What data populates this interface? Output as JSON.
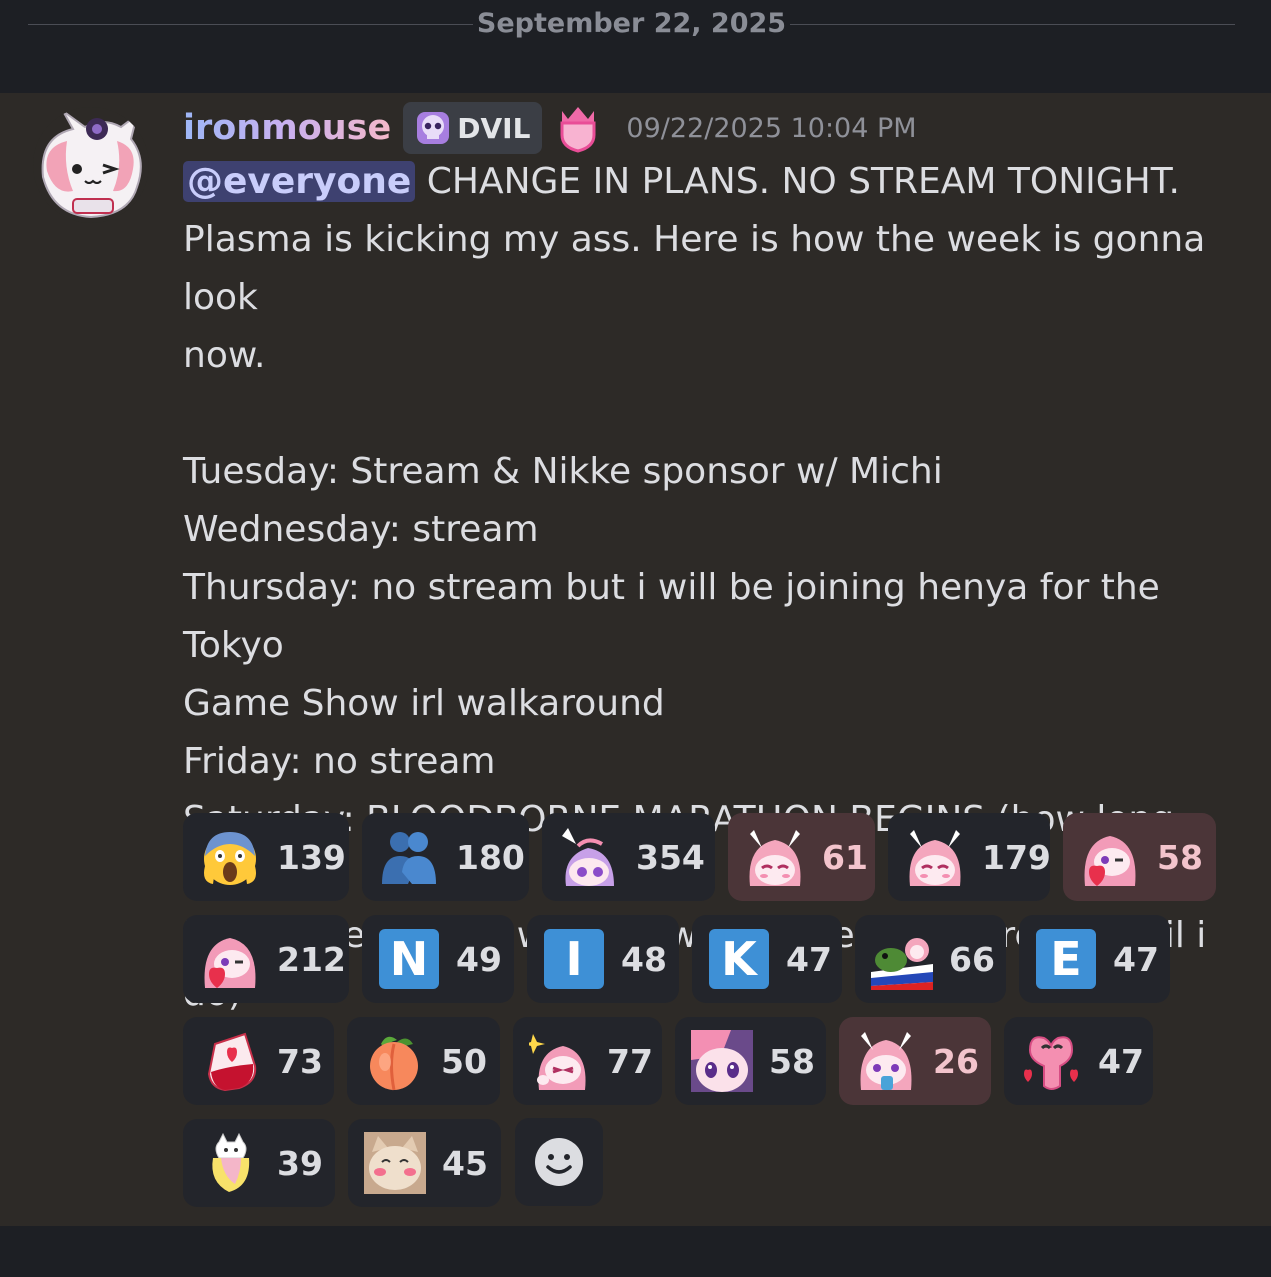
{
  "divider": {
    "date": "September 22, 2025"
  },
  "message": {
    "username": "ironmouse",
    "tag_label": "DVIL",
    "timestamp": "09/22/2025 10:04 PM",
    "mention": "@everyone",
    "line_1": " CHANGE IN PLANS. NO STREAM TONIGHT.",
    "line_2": "Plasma is kicking my ass. Here is how the week is gonna look",
    "line_3": "now.",
    "schedule": [
      "Tuesday: Stream & Nikke sponsor w/ Michi",
      "Wednesday: stream",
      "Thursday: no stream but i will be joining henya for the Tokyo",
      "Game Show irl walkaround",
      "Friday: no stream",
      "Saturday: BLOODBORNE MARATHON BEGINS (how long will",
      "it take me to beat who knows... not ending stream until i do)"
    ]
  },
  "reactions": [
    {
      "emoji": "scream-emoji",
      "count": "139",
      "active": false
    },
    {
      "emoji": "people-hugging-emoji",
      "count": "180",
      "active": false
    },
    {
      "emoji": "mouse-peek-emoji",
      "count": "354",
      "active": false
    },
    {
      "emoji": "mouse-blush-emoji",
      "count": "61",
      "active": true
    },
    {
      "emoji": "mouse-blush-emoji",
      "count": "179",
      "active": false
    },
    {
      "emoji": "mouse-heart-emoji",
      "count": "58",
      "active": true
    },
    {
      "emoji": "mouse-heart-emoji",
      "count": "212",
      "active": false
    },
    {
      "emoji": "letter-n-emoji",
      "letter": "N",
      "count": "49",
      "active": false
    },
    {
      "emoji": "letter-i-emoji",
      "letter": "I",
      "count": "48",
      "active": false
    },
    {
      "emoji": "letter-k-emoji",
      "letter": "K",
      "count": "47",
      "active": false
    },
    {
      "emoji": "frog-flag-emoji",
      "count": "66",
      "active": false
    },
    {
      "emoji": "letter-e-emoji",
      "letter": "E",
      "count": "47",
      "active": false
    },
    {
      "emoji": "blood-bag-emoji",
      "count": "73",
      "active": false
    },
    {
      "emoji": "peach-emoji",
      "count": "50",
      "active": false
    },
    {
      "emoji": "mouse-sparkle-emoji",
      "count": "77",
      "active": false
    },
    {
      "emoji": "purple-hair-emoji",
      "count": "58",
      "active": false
    },
    {
      "emoji": "mouse-drink-emoji",
      "count": "26",
      "active": true
    },
    {
      "emoji": "pink-heart-creature-emoji",
      "count": "47",
      "active": false
    },
    {
      "emoji": "banana-cat-emoji",
      "count": "39",
      "active": false
    },
    {
      "emoji": "cat-blush-emoji",
      "count": "45",
      "active": false
    }
  ],
  "add_reaction": {
    "icon": "add-reaction-smile-icon"
  },
  "colors": {
    "background": "#1d1f24",
    "message_bg": "#2d2a27",
    "mention_bg": "#3e4170",
    "reaction_bg": "#23252b",
    "reaction_active_bg": "#4b3538",
    "letter_tile": "#3e90d6"
  }
}
